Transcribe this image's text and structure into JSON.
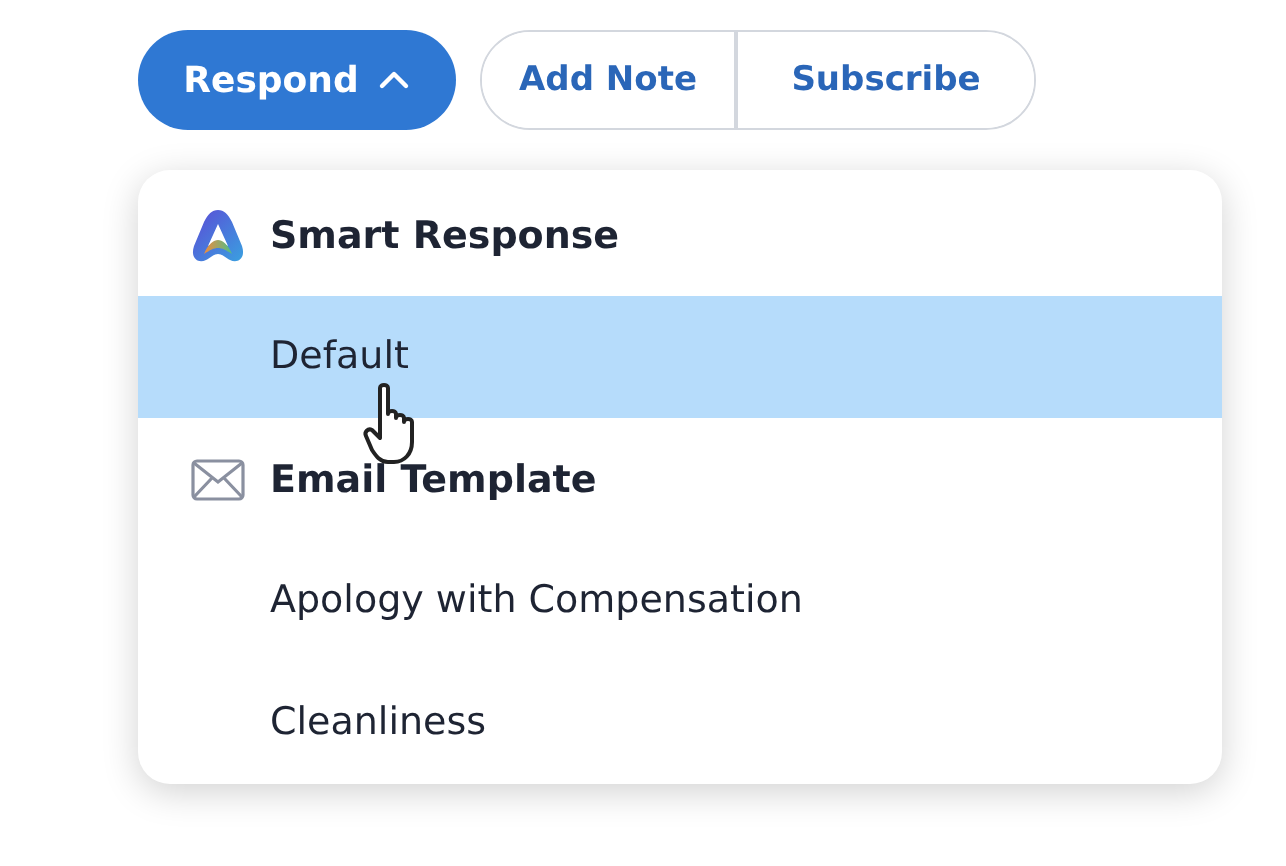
{
  "actions": {
    "respond": {
      "label": "Respond",
      "expanded": true
    },
    "buttons": [
      {
        "label": "Add Note"
      },
      {
        "label": "Subscribe"
      }
    ]
  },
  "menu": {
    "groups": [
      {
        "title": "Smart Response",
        "items": [
          {
            "label": "Default",
            "selected": true
          }
        ]
      },
      {
        "title": "Email Template",
        "items": [
          {
            "label": "Apology with Compensation",
            "selected": false
          },
          {
            "label": "Cleanliness",
            "selected": false
          }
        ]
      }
    ]
  }
}
